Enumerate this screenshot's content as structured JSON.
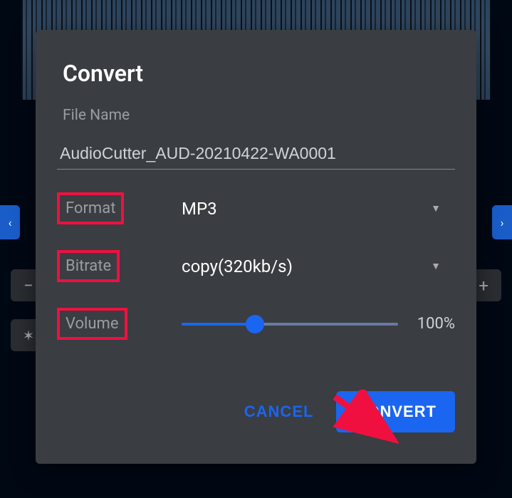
{
  "dialog": {
    "title": "Convert",
    "file_name_label": "File Name",
    "file_name_value": "AudioCutter_AUD-20210422-WA0001",
    "format_label": "Format",
    "format_value": "MP3",
    "bitrate_label": "Bitrate",
    "bitrate_value": "copy(320kb/s)",
    "volume_label": "Volume",
    "volume_value": "100%",
    "cancel_label": "CANCEL",
    "convert_label": "CONVERT"
  },
  "nav": {
    "prev": "‹",
    "next": "›",
    "minus": "−",
    "plus": "+",
    "gear": "✶"
  }
}
